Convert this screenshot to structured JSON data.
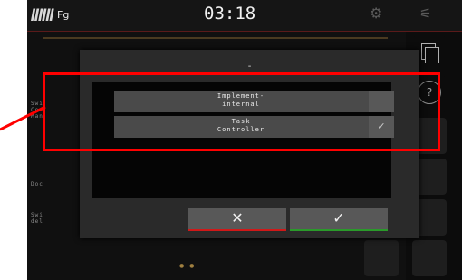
{
  "topbar": {
    "logo_text": "ǁǁǁ",
    "mode_label": "Fg",
    "time": "03:18",
    "tractor_icon": "tractor-icon",
    "gps_icon": "gps-off-icon"
  },
  "background_rows": [
    {
      "text": "Swi\nCon\nMan"
    },
    {
      "text": "Doc"
    },
    {
      "text": "Swi\ndel"
    }
  ],
  "right_column": {
    "copy_icon": "copy-icon",
    "help_icon": "help-icon",
    "help_label": "?"
  },
  "pagination_dots": "● ●",
  "dialog": {
    "title": "-",
    "options": [
      {
        "label": "Implement-\ninternal",
        "selected": false
      },
      {
        "label": "Task\nController",
        "selected": true,
        "check_glyph": "✓"
      }
    ],
    "cancel_glyph": "✕",
    "confirm_glyph": "✓"
  },
  "colors": {
    "highlight": "#ff0000",
    "cancel_accent": "#d01818",
    "confirm_accent": "#2a9a2a"
  }
}
